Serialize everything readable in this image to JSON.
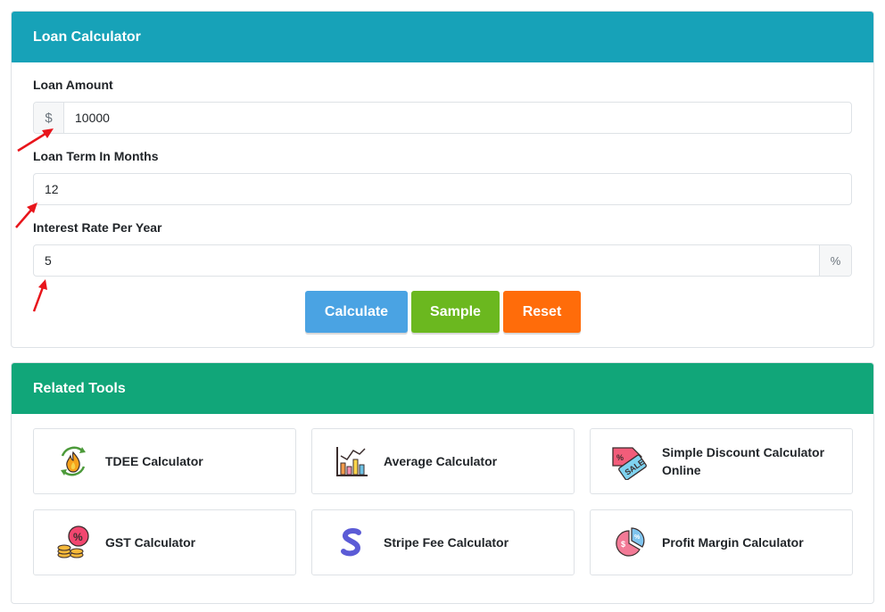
{
  "loan_calculator": {
    "title": "Loan Calculator",
    "loan_amount": {
      "label": "Loan Amount",
      "prefix": "$",
      "value": "10000"
    },
    "loan_term": {
      "label": "Loan Term In Months",
      "value": "12"
    },
    "interest_rate": {
      "label": "Interest Rate Per Year",
      "value": "5",
      "suffix": "%"
    },
    "buttons": {
      "calculate": "Calculate",
      "sample": "Sample",
      "reset": "Reset"
    }
  },
  "related_tools": {
    "title": "Related Tools",
    "items": [
      {
        "label": "TDEE Calculator",
        "icon": "fire-cycle-icon"
      },
      {
        "label": "Average Calculator",
        "icon": "bar-chart-icon"
      },
      {
        "label": "Simple Discount Calculator Online",
        "icon": "sale-tag-icon"
      },
      {
        "label": "GST Calculator",
        "icon": "percent-coins-icon"
      },
      {
        "label": "Stripe Fee Calculator",
        "icon": "stripe-s-icon"
      },
      {
        "label": "Profit Margin Calculator",
        "icon": "pie-chart-icon"
      }
    ]
  },
  "colors": {
    "loan_header": "#17a2b8",
    "tools_header": "#11a679",
    "calculate": "#4aa3e3",
    "sample": "#6bb81f",
    "reset": "#ff6c0a",
    "annotation_arrow": "#e8151b"
  }
}
